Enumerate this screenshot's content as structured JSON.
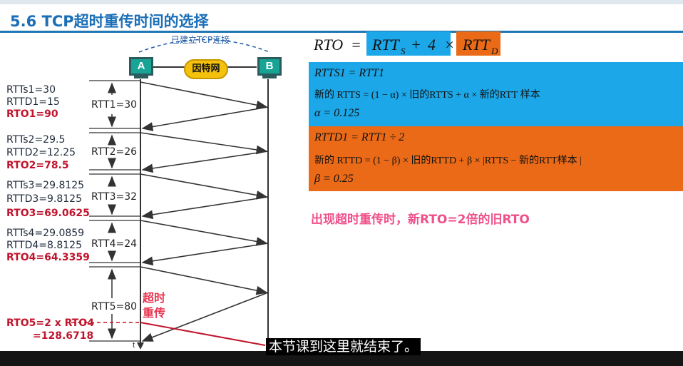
{
  "slide": {
    "title": "5.6 TCP超时重传时间的选择",
    "connection_label": "已建立TCP连接",
    "network_label": "因特网",
    "host_a": "A",
    "host_b": "B",
    "time_axis": "t",
    "timeout_label_1": "超时",
    "timeout_label_2": "重传"
  },
  "rounds": [
    {
      "rtts": "RTTs1=30",
      "rttd": "RTTD1=15",
      "rto": "RTO1=90",
      "rtt": "RTT1=30"
    },
    {
      "rtts": "RTTs2=29.5",
      "rttd": "RTTD2=12.25",
      "rto": "RTO2=78.5",
      "rtt": "RTT2=26"
    },
    {
      "rtts": "RTTs3=29.8125",
      "rttd": "RTTD3=9.8125",
      "rto": "RTO3=69.0625",
      "rtt": "RTT3=32"
    },
    {
      "rtts": "RTTs4=29.0859",
      "rttd": "RTTD4=8.8125",
      "rto": "RTO4=64.3359",
      "rtt": "RTT4=24"
    }
  ],
  "round5": {
    "rtt": "RTT5=80",
    "rto": "RTO5=2 x RTO4",
    "rto_value": "=128.6718"
  },
  "formula": {
    "lhs": "RTO",
    "eq": "=",
    "term1": "RTT",
    "term1_sub": "S",
    "plus": "+",
    "four": "4",
    "times": "×",
    "term2": "RTT",
    "term2_sub": "D"
  },
  "blue_panel": {
    "line1": "RTTS1 = RTT1",
    "line2": "新的 RTTS = (1 − α) × 旧的RTTS + α × 新的RTT 样本",
    "line3": "α = 0.125"
  },
  "orange_panel": {
    "line1": "RTTD1 = RTT1 ÷ 2",
    "line2": "新的 RTTD = (1 − β) × 旧的RTTD + β × |RTTS − 新的RTT样本 |",
    "line3": "β = 0.25"
  },
  "note": "出现超时重传时，新RTO=2倍的旧RTO",
  "caption": "本节课到这里就结束了。",
  "colors": {
    "title": "#1b6fb7",
    "blue": "#1ca7e8",
    "orange": "#ea6a18",
    "red": "#c0142c",
    "note": "#f0508a"
  }
}
